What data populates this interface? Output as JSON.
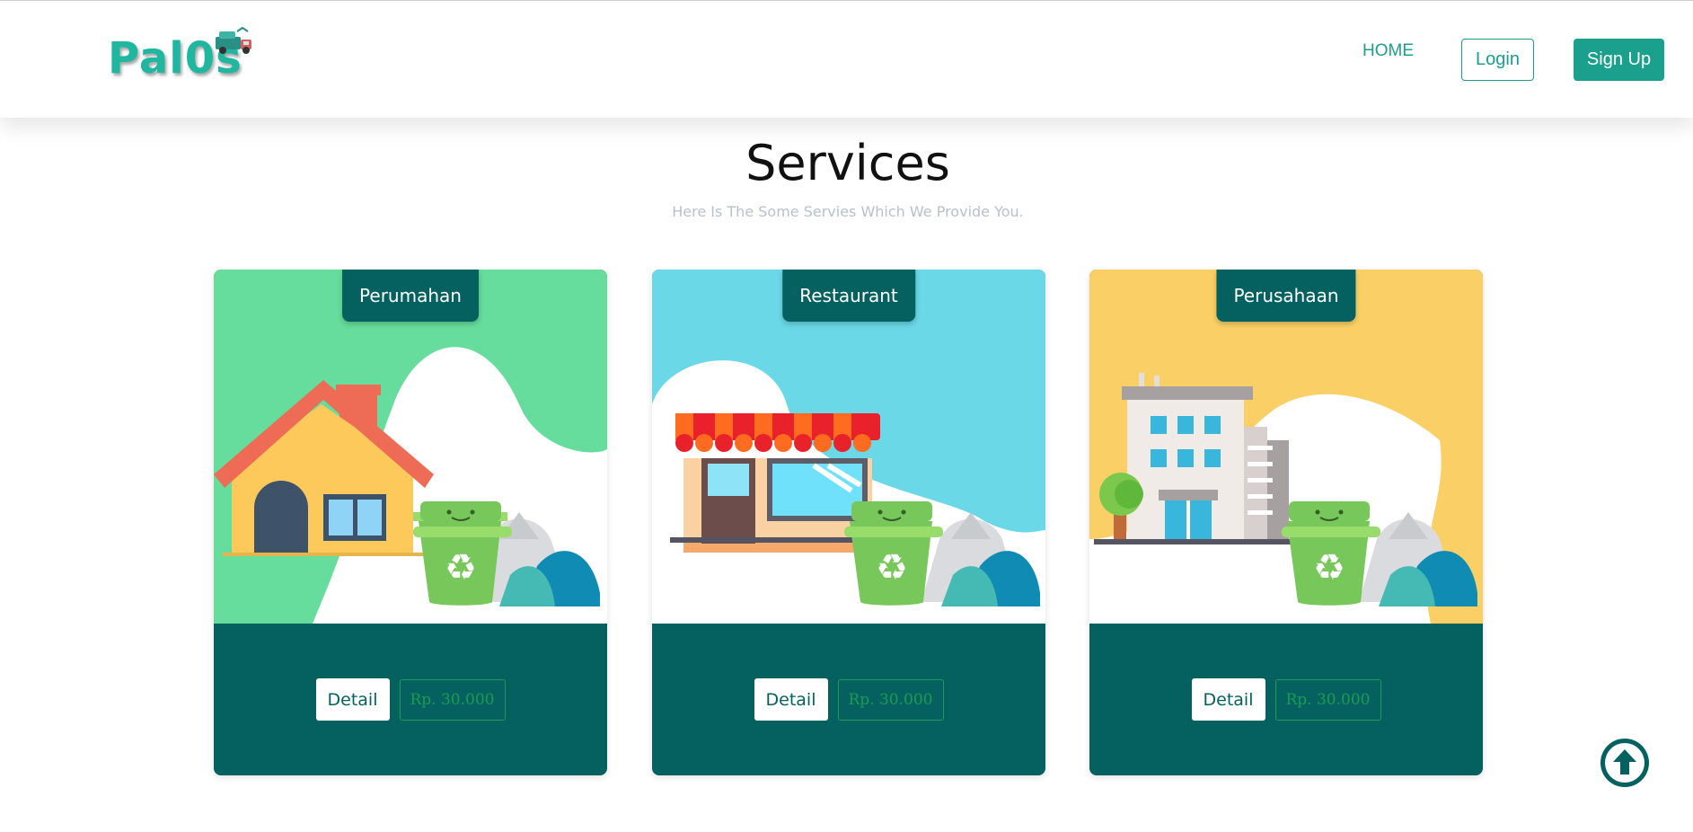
{
  "navbar": {
    "logo_text": "Pal0s",
    "home_label": "HOME",
    "login_label": "Login",
    "signup_label": "Sign Up"
  },
  "services": {
    "title": "Services",
    "subtitle": "Here Is The Some Servies Which We Provide You.",
    "cards": [
      {
        "tag": "Perumahan",
        "detail_label": "Detail",
        "price": "Rp. 30.000",
        "bg_color": "#66dd9c",
        "illustration": "house-icon"
      },
      {
        "tag": "Restaurant",
        "detail_label": "Detail",
        "price": "Rp. 30.000",
        "bg_color": "#6ad8e6",
        "illustration": "shop-icon"
      },
      {
        "tag": "Perusahaan",
        "detail_label": "Detail",
        "price": "Rp. 30.000",
        "bg_color": "#fad066",
        "illustration": "office-building-icon"
      }
    ]
  },
  "colors": {
    "brand": "#1aa08d",
    "card_footer": "#046160",
    "price_outline": "#1c9b52"
  }
}
